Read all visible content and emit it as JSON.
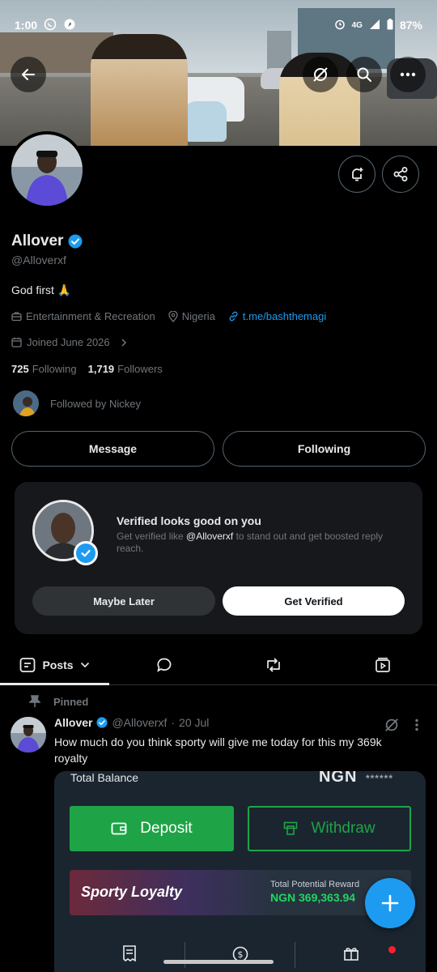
{
  "status_bar": {
    "time": "1:00",
    "network": "4G",
    "battery": "87%"
  },
  "profile": {
    "name": "Allover",
    "handle": "@Alloverxf",
    "bio": "God first 🙏",
    "category": "Entertainment & Recreation",
    "location": "Nigeria",
    "link": "t.me/bashthemagi",
    "joined": "Joined June 2026",
    "following_count": "725",
    "following_label": "Following",
    "followers_count": "1,719",
    "followers_label": "Followers",
    "followed_by": "Followed by Nickey"
  },
  "actions": {
    "message": "Message",
    "following": "Following"
  },
  "verify_card": {
    "title": "Verified looks good on you",
    "text_prefix": "Get verified like ",
    "text_handle": "@Alloverxf",
    "text_suffix": " to stand out and get boosted reply reach.",
    "maybe_later": "Maybe Later",
    "get_verified": "Get Verified"
  },
  "tabs": {
    "posts": "Posts"
  },
  "post": {
    "pinned_label": "Pinned",
    "author": "Allover",
    "handle": "@Alloverxf",
    "separator": "·",
    "date": "20 Jul",
    "text": "How much do you think sporty will give me today for this my 369k royalty",
    "media": {
      "total_balance": "Total Balance",
      "currency": "NGN",
      "masked": "******",
      "deposit": "Deposit",
      "withdraw": "Withdraw",
      "loyalty_title": "Sporty Loyalty",
      "potential_reward_label": "Total Potential Reward",
      "potential_reward_value": "NGN 369,363.94"
    }
  },
  "colors": {
    "accent_blue": "#1d9bf0",
    "background": "#000000",
    "muted_text": "#71767b",
    "sporty_green": "#1ea446"
  }
}
